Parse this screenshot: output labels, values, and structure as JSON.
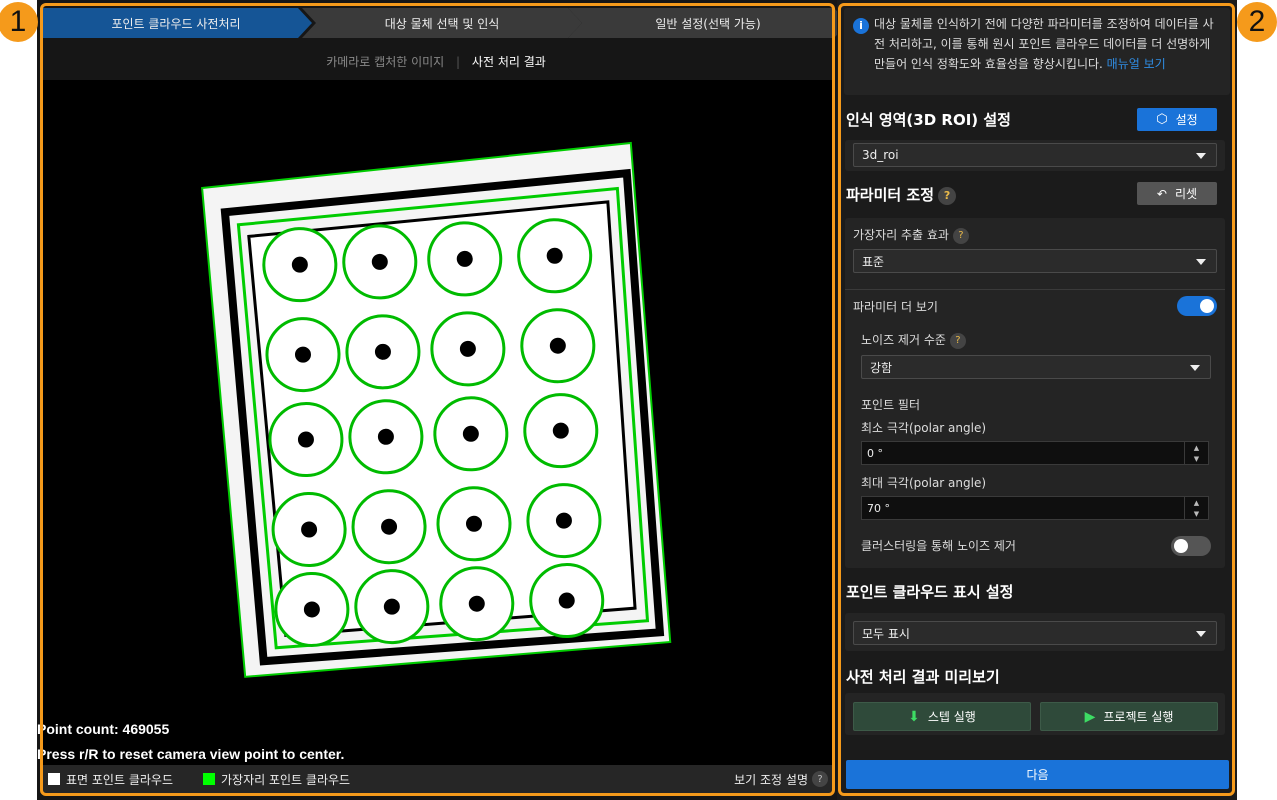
{
  "badges": {
    "left": "1",
    "right": "2"
  },
  "steps": [
    {
      "label": "포인트 클라우드 사전처리",
      "active": true
    },
    {
      "label": "대상 물체 선택 및 인식",
      "active": false
    },
    {
      "label": "일반 설정(선택 가능)",
      "active": false
    }
  ],
  "view_tabs": {
    "camera": "카메라로 캡처한 이미지",
    "separator": "|",
    "result": "사전 처리 결과"
  },
  "viewer": {
    "point_count": "Point count: 469055",
    "hint": "Press r/R to reset camera view point to center."
  },
  "legend": {
    "surface": "표면 포인트 클라우드",
    "edge": "가장자리 포인트 클라우드",
    "help": "보기 조정 설명",
    "help_icon": "?",
    "surface_color": "#ffffff",
    "edge_color": "#00ff00"
  },
  "info": {
    "text": "대상 물체를 인식하기 전에 다양한 파라미터를 조정하여 데이터를 사전 처리하고, 이를 통해 원시 포인트 클라우드 데이터를 더 선명하게 만들어 인식 정확도와 효율성을 향상시킵니다.",
    "link": "매뉴얼 보기"
  },
  "roi": {
    "title": "인식 영역(3D ROI) 설정",
    "button": "설정",
    "value": "3d_roi"
  },
  "params": {
    "title": "파라미터 조정",
    "reset": "리셋",
    "edge_effect_label": "가장자리 추출 효과",
    "edge_effect_value": "표준",
    "more_label": "파라미터 더 보기",
    "more_on": true,
    "noise_label": "노이즈 제거 수준",
    "noise_value": "강함",
    "filter_label": "포인트 필터",
    "min_label": "최소 극각(polar angle)",
    "min_value": "0 °",
    "max_label": "최대 극각(polar angle)",
    "max_value": "70 °",
    "cluster_label": "클러스터링을 통해 노이즈 제거",
    "cluster_on": false,
    "help": "?"
  },
  "display": {
    "title": "포인트 클라우드 표시 설정",
    "value": "모두 표시"
  },
  "preview": {
    "title": "사전 처리 결과 미리보기",
    "step_run": "스텝 실행",
    "project_run": "프로젝트 실행"
  },
  "next": "다음",
  "accent": "#1a73d9"
}
